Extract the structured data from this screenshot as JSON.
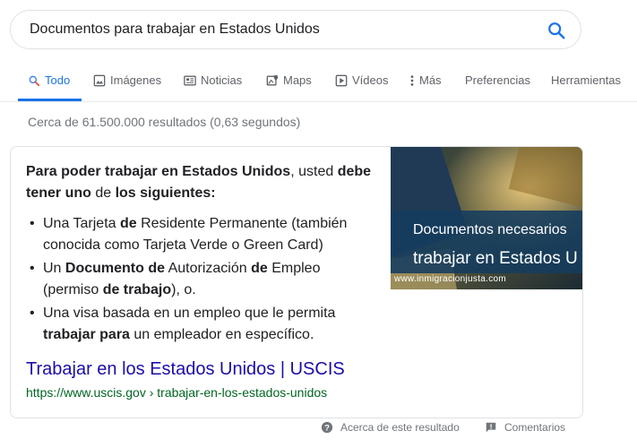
{
  "search": {
    "query": "Documentos para trabajar en Estados Unidos",
    "icon": "search-icon"
  },
  "tabs": [
    {
      "label": "Todo",
      "icon": "search-icon"
    },
    {
      "label": "Imágenes",
      "icon": "image-icon"
    },
    {
      "label": "Noticias",
      "icon": "news-icon"
    },
    {
      "label": "Maps",
      "icon": "map-icon"
    },
    {
      "label": "Vídeos",
      "icon": "video-icon"
    },
    {
      "label": "Más",
      "icon": "more-vert-icon"
    },
    {
      "label": "Preferencias"
    },
    {
      "label": "Herramientas"
    }
  ],
  "stats": "Cerca de 61.500.000 resultados (0,63 segundos)",
  "snippet": {
    "lead": [
      {
        "text": "Para poder ",
        "bold": true
      },
      {
        "text": "trabajar en Estados Unidos",
        "bold": true
      },
      {
        "text": ", usted ",
        "bold": false
      },
      {
        "text": "debe tener uno",
        "bold": true
      },
      {
        "text": " de ",
        "bold": false
      },
      {
        "text": "los siguientes:",
        "bold": true
      }
    ],
    "items": [
      [
        {
          "text": "Una Tarjeta ",
          "bold": false
        },
        {
          "text": "de",
          "bold": true
        },
        {
          "text": " Residente Permanente (también conocida como Tarjeta Verde o Green Card)",
          "bold": false
        }
      ],
      [
        {
          "text": "Un ",
          "bold": false
        },
        {
          "text": "Documento de",
          "bold": true
        },
        {
          "text": " Autorización ",
          "bold": false
        },
        {
          "text": "de",
          "bold": true
        },
        {
          "text": " Empleo (permiso ",
          "bold": false
        },
        {
          "text": "de trabajo",
          "bold": true
        },
        {
          "text": "), o.",
          "bold": false
        }
      ],
      [
        {
          "text": "Una visa basada en un empleo que le permita ",
          "bold": false
        },
        {
          "text": "trabajar para",
          "bold": true
        },
        {
          "text": " un empleador en específico.",
          "bold": false
        }
      ]
    ],
    "image": {
      "line1": "Documentos necesarios",
      "line2": "trabajar en Estados U",
      "caption": "www.inmigracionjusta.com"
    },
    "link_title": "Trabajar en los Estados Unidos | USCIS",
    "url": "https://www.uscis.gov › trabajar-en-los-estados-unidos"
  },
  "footer": {
    "about": "Acerca de este resultado",
    "feedback": "Comentarios"
  },
  "colors": {
    "accent": "#1a73e8",
    "link": "#1a0dab",
    "url": "#006621"
  }
}
